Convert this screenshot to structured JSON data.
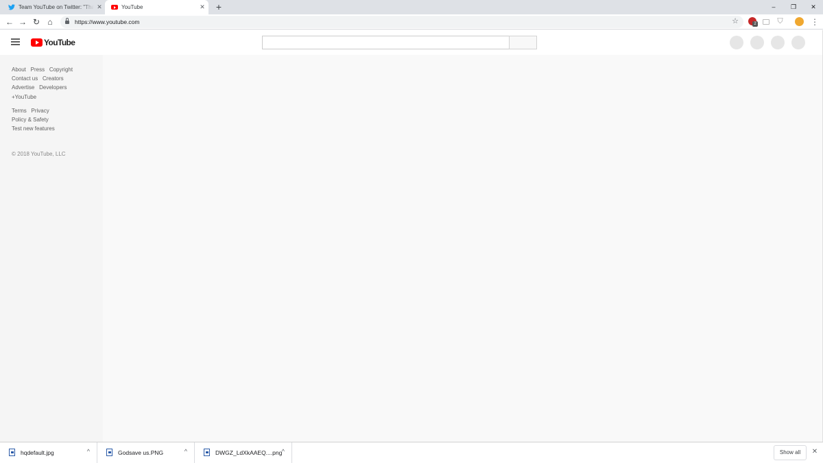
{
  "browser": {
    "tabs": [
      {
        "title": "Team YouTube on Twitter: \"Thanks",
        "favicon": "twitter-bird-icon",
        "active": false
      },
      {
        "title": "YouTube",
        "favicon": "youtube-favicon-icon",
        "active": true
      }
    ],
    "new_tab_label": "+",
    "window_controls": {
      "minimize": "–",
      "restore": "❐",
      "close": "✕"
    },
    "nav": {
      "back": "←",
      "forward": "→",
      "reload": "↻",
      "home": "⌂"
    },
    "url": "https://www.youtube.com",
    "star": "☆",
    "extension_badge": "2",
    "menu": "⋮"
  },
  "youtube": {
    "logo_text": "YouTube",
    "footer": {
      "primary_links": [
        [
          "About",
          "Press",
          "Copyright"
        ],
        [
          "Contact us",
          "Creators"
        ],
        [
          "Advertise",
          "Developers"
        ],
        [
          "+YouTube"
        ]
      ],
      "secondary_links": [
        [
          "Terms",
          "Privacy"
        ],
        [
          "Policy & Safety"
        ],
        [
          "Test new features"
        ]
      ],
      "copyright": "© 2018 YouTube, LLC"
    }
  },
  "downloads": {
    "items": [
      {
        "name": "hqdefault.jpg"
      },
      {
        "name": "Godsave us.PNG"
      },
      {
        "name": "DWGZ_LdXkAAEQ....png"
      }
    ],
    "chevron": "^",
    "show_all_label": "Show all",
    "close": "✕"
  },
  "colors": {
    "youtube_red": "#ff0000",
    "twitter_blue": "#1da1f2",
    "page_background": "#f9f9f9",
    "guide_background": "#f5f5f5"
  }
}
